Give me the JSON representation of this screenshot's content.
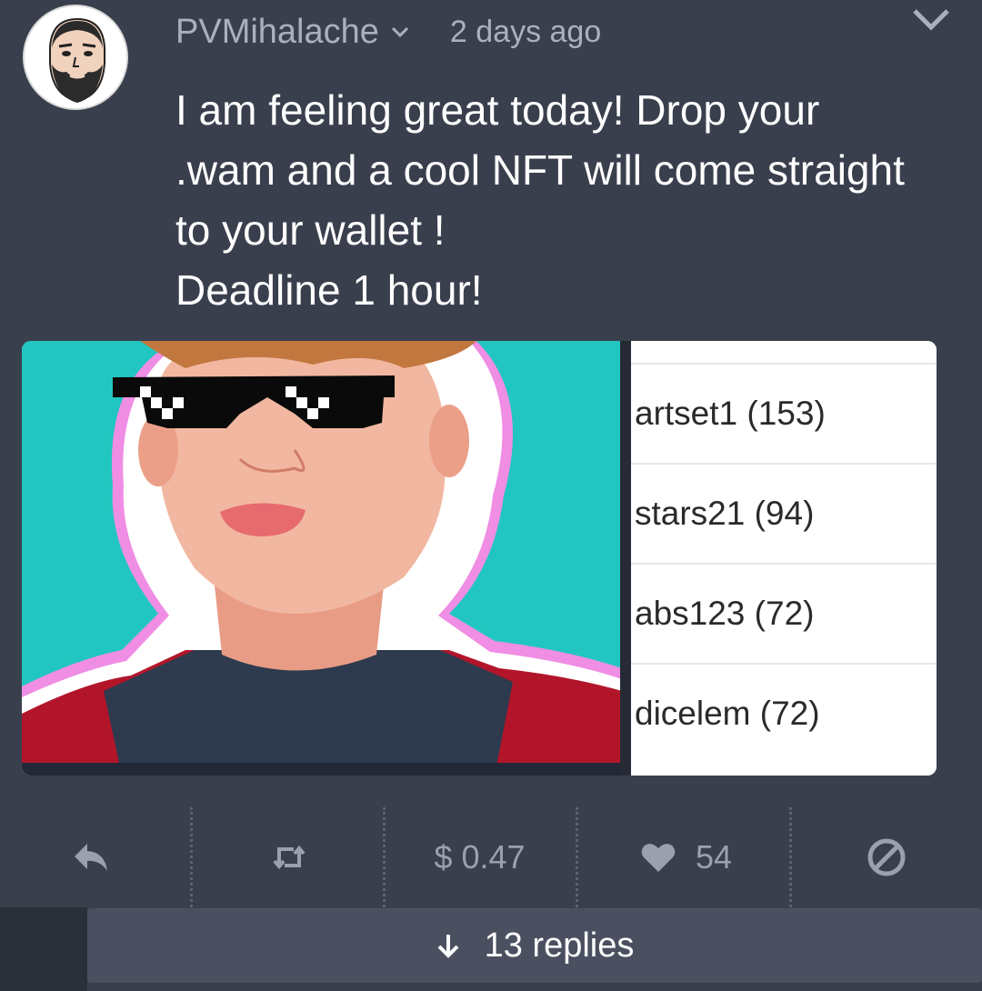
{
  "post": {
    "username": "PVMihalache",
    "time": "2 days ago",
    "text_lines": [
      "I am feeling great today! Drop your",
      ".wam and a cool NFT will come straight",
      "to your wallet !",
      "Deadline 1 hour!"
    ]
  },
  "media": {
    "list_items": [
      "artset1 (153)",
      "stars21 (94)",
      "abs123 (72)",
      "dicelem (72)"
    ]
  },
  "actions": {
    "reply_icon": "reply-icon",
    "repost_icon": "repost-icon",
    "payout": "$ 0.47",
    "likes": "54",
    "like_icon": "heart-icon",
    "flag_icon": "block-icon"
  },
  "replies": {
    "label": "13 replies",
    "icon": "arrow-down-icon"
  },
  "colors": {
    "background": "#3a3f4d",
    "muted_text": "#9aa0ad",
    "replies_bar": "#4a505f"
  }
}
